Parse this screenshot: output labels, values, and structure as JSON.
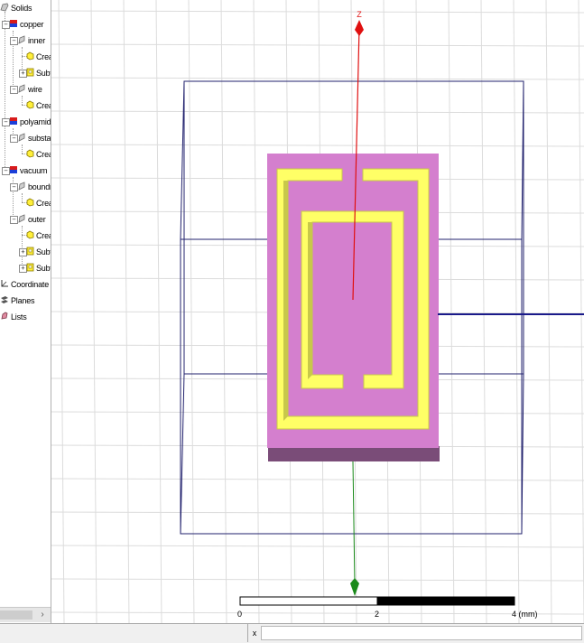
{
  "tree": {
    "items": [
      {
        "label": "Solids",
        "icon": "solids-folder-icon"
      },
      {
        "label": "copper",
        "icon": "material-copper-icon"
      },
      {
        "label": "inner",
        "icon": "solid-object-icon"
      },
      {
        "label": "Crea",
        "icon": "create-command-icon"
      },
      {
        "label": "Subt",
        "icon": "subtract-command-icon"
      },
      {
        "label": "wire",
        "icon": "solid-object-icon"
      },
      {
        "label": "Crea",
        "icon": "create-command-icon"
      },
      {
        "label": "polyamide",
        "icon": "material-polyamide-icon"
      },
      {
        "label": "substart",
        "icon": "solid-object-icon"
      },
      {
        "label": "Crea",
        "icon": "create-command-icon"
      },
      {
        "label": "vacuum",
        "icon": "material-vacuum-icon"
      },
      {
        "label": "boundr",
        "icon": "solid-object-icon"
      },
      {
        "label": "Crea",
        "icon": "create-command-icon"
      },
      {
        "label": "outer",
        "icon": "solid-object-icon"
      },
      {
        "label": "Crea",
        "icon": "create-command-icon"
      },
      {
        "label": "Subt",
        "icon": "subtract-command-icon"
      },
      {
        "label": "Subt",
        "icon": "subtract-command-icon"
      },
      {
        "label": "Coordinate Sys",
        "icon": "coordinate-system-icon"
      },
      {
        "label": "Planes",
        "icon": "planes-icon"
      },
      {
        "label": "Lists",
        "icon": "lists-icon"
      }
    ],
    "scroll_arrow": "›"
  },
  "viewport": {
    "axis_label": "Z",
    "scale": {
      "labels": [
        "0",
        "2",
        "4 (mm)"
      ]
    },
    "colors": {
      "substrate_top": "#d47fce",
      "substrate_edge": "#7a4c78",
      "copper": "#ffff66",
      "copper_edge": "#c8c84a",
      "z_axis": "#e01010",
      "y_axis": "#1a8a1a",
      "x_axis": "#1a1a8a",
      "box_lines": "#22226e",
      "grid": "#dcdcdc"
    }
  },
  "bottom": {
    "close_label": "x"
  }
}
